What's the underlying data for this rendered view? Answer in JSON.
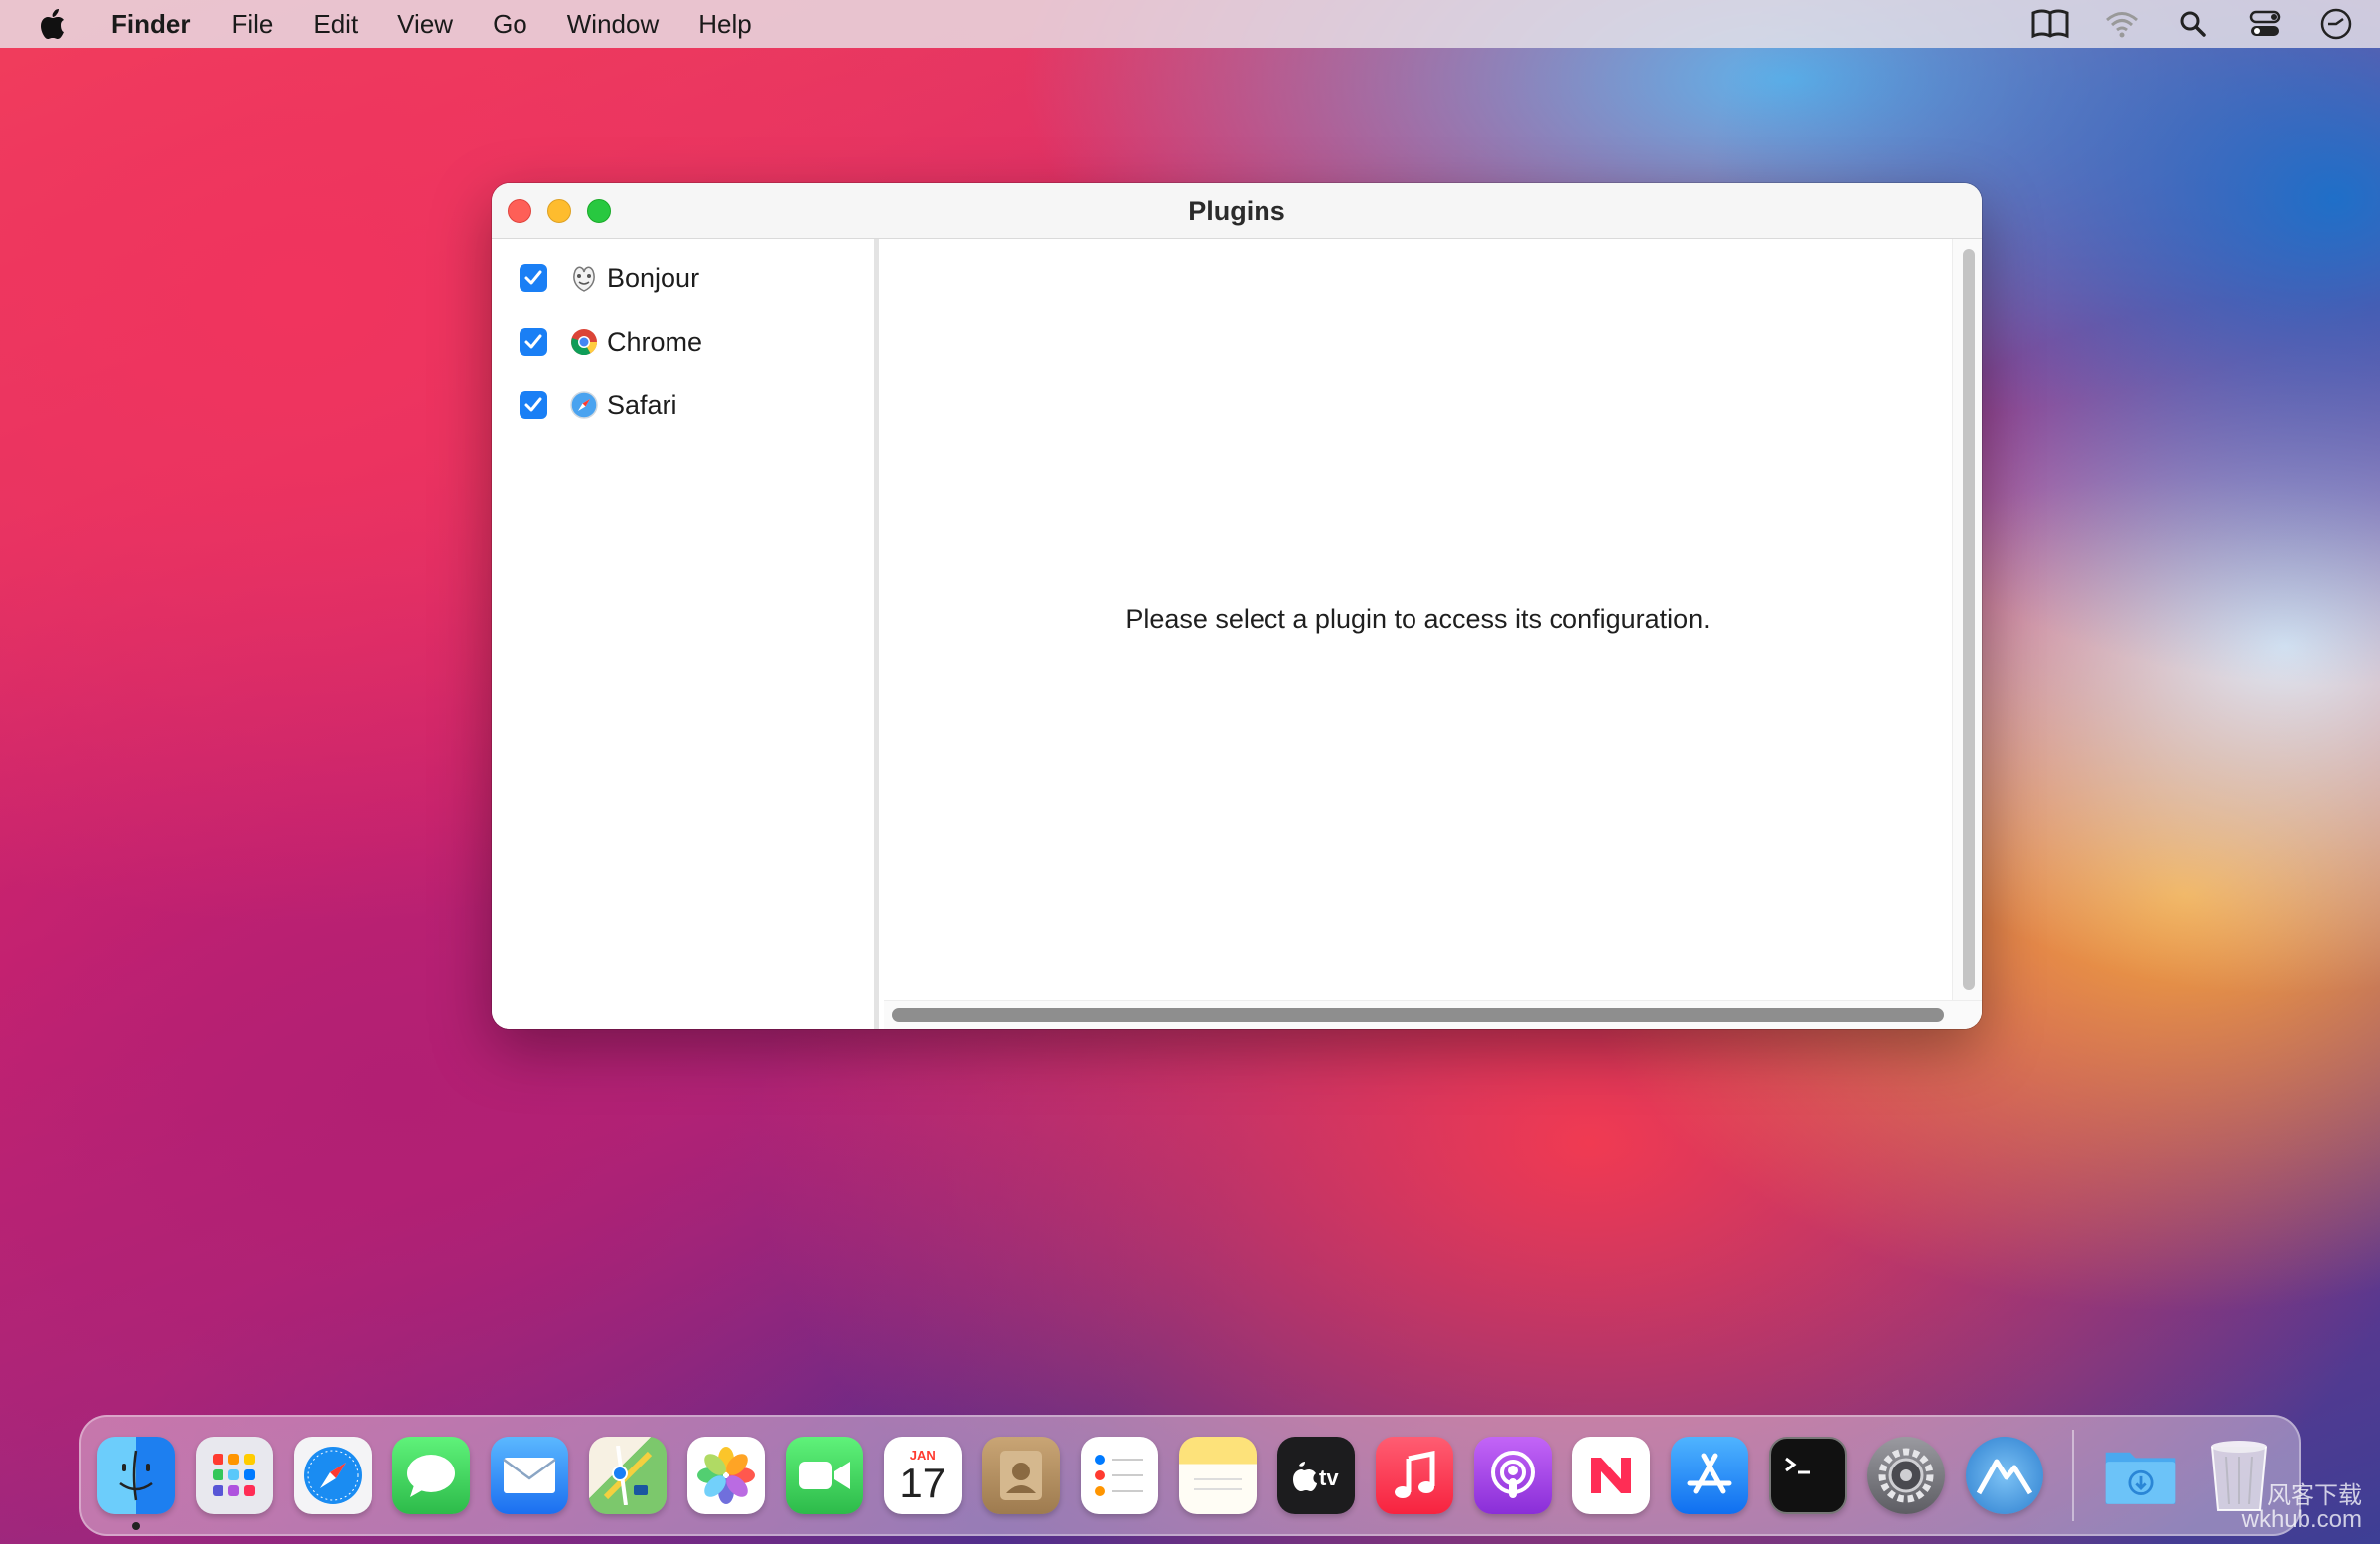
{
  "menubar": {
    "app_name": "Finder",
    "items": [
      "File",
      "Edit",
      "View",
      "Go",
      "Window",
      "Help"
    ],
    "status_icons": [
      "reading-list-icon",
      "wifi-icon",
      "spotlight-search-icon",
      "control-center-icon",
      "clock-icon"
    ]
  },
  "window": {
    "title": "Plugins",
    "plugins": [
      {
        "label": "Bonjour",
        "checked": true,
        "icon": "bonjour-icon"
      },
      {
        "label": "Chrome",
        "checked": true,
        "icon": "chrome-icon"
      },
      {
        "label": "Safari",
        "checked": true,
        "icon": "safari-icon"
      }
    ],
    "empty_message": "Please select a plugin to access its configuration."
  },
  "dock": {
    "apps": [
      {
        "name": "finder-icon",
        "color": "#2a8ff0"
      },
      {
        "name": "launchpad-icon",
        "color": "#e9e9ee"
      },
      {
        "name": "safari-icon",
        "color": "#1a8cf2"
      },
      {
        "name": "messages-icon",
        "color": "#34c759"
      },
      {
        "name": "mail-icon",
        "color": "#2f8cf4"
      },
      {
        "name": "maps-icon",
        "color": "#7cc86c"
      },
      {
        "name": "photos-icon",
        "color": "#ffffff"
      },
      {
        "name": "facetime-icon",
        "color": "#30c255"
      },
      {
        "name": "calendar-icon",
        "color": "#ffffff"
      },
      {
        "name": "contacts-icon",
        "color": "#b28a5c"
      },
      {
        "name": "reminders-icon",
        "color": "#ffffff"
      },
      {
        "name": "notes-icon",
        "color": "#fde27a"
      },
      {
        "name": "tv-icon",
        "color": "#1c1c1e"
      },
      {
        "name": "music-icon",
        "color": "#fa2d48"
      },
      {
        "name": "podcasts-icon",
        "color": "#9b43e6"
      },
      {
        "name": "news-icon",
        "color": "#ffffff"
      },
      {
        "name": "app-store-icon",
        "color": "#1d8cf3"
      },
      {
        "name": "terminal-icon",
        "color": "#111111"
      },
      {
        "name": "system-preferences-icon",
        "color": "#7c7c80"
      },
      {
        "name": "mountain-app-icon",
        "color": "#3b8fd9"
      }
    ],
    "calendar": {
      "month": "JAN",
      "day": "17"
    },
    "stack": {
      "name": "downloads-folder-icon",
      "color": "#5ab8f3"
    },
    "trash": {
      "name": "trash-icon"
    }
  },
  "watermark": {
    "line1": "风客下载",
    "line2": "wkhub.com"
  }
}
